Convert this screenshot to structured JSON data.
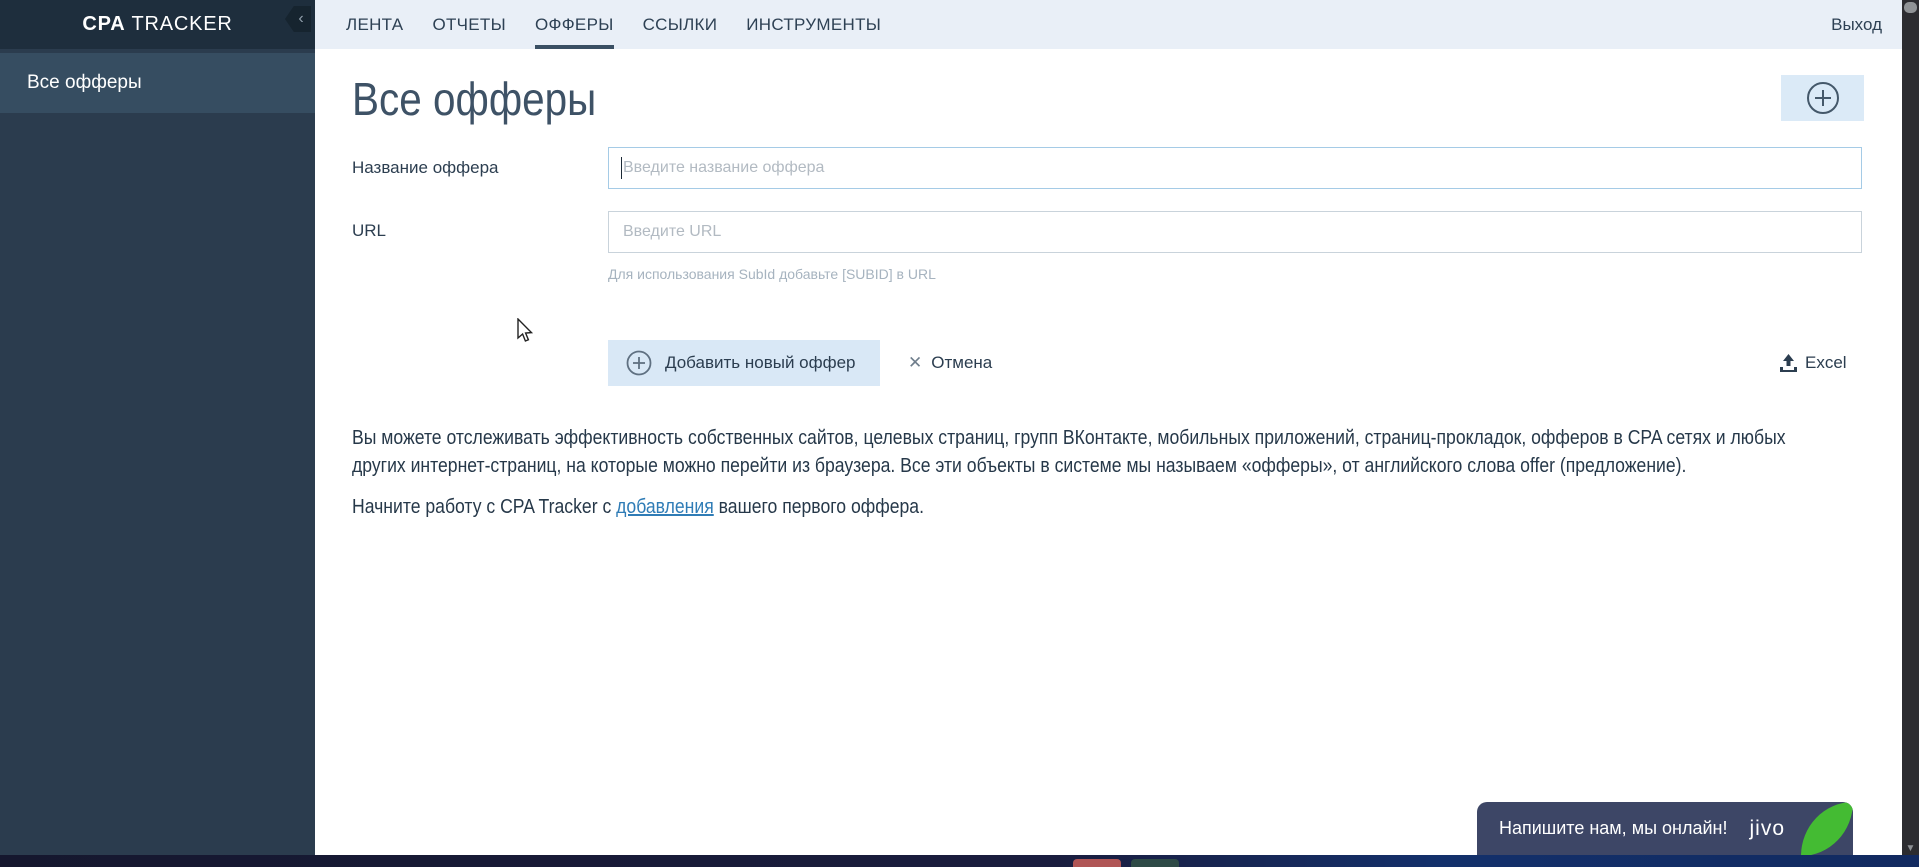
{
  "app": {
    "logo_bold": "CPA",
    "logo_rest": " TRACKER"
  },
  "sidebar": {
    "items": [
      {
        "label": "Все офферы",
        "active": true
      }
    ]
  },
  "nav": {
    "tabs": [
      {
        "label": "ЛЕНТА"
      },
      {
        "label": "ОТЧЕТЫ"
      },
      {
        "label": "ОФФЕРЫ",
        "active": true
      },
      {
        "label": "ССЫЛКИ"
      },
      {
        "label": "ИНСТРУМЕНТЫ"
      }
    ],
    "logout_label": "Выход"
  },
  "main": {
    "title": "Все офферы",
    "form": {
      "name_label": "Название оффера",
      "name_value": "",
      "name_placeholder": "Введите название оффера",
      "url_label": "URL",
      "url_value": "",
      "url_placeholder": "Введите URL",
      "url_hint": "Для использования SubId добавьте [SUBID] в URL",
      "submit_label": "Добавить новый оффер",
      "cancel_label": "Отмена",
      "excel_label": "Excel"
    },
    "description_p1": "Вы можете отслеживать эффективность собственных сайтов, целевых страниц, групп ВКонтакте, мобильных приложений, страниц-прокладок, офферов в CPA сетях и любых других интернет-страниц, на которые можно перейти из браузера. Все эти объекты в системе мы называем «офферы», от английского слова offer (предложение).",
    "description_p2_before": "Начните работу с CPA Tracker с ",
    "description_p2_link": "добавления",
    "description_p2_after": " вашего первого оффера."
  },
  "chat": {
    "message": "Напишите нам, мы онлайн!",
    "brand": "jivo"
  },
  "icons": {
    "collapse_chevron": "‹",
    "cancel_x": "✕",
    "scroll_down_arrow": "▼"
  },
  "colors": {
    "sidebar_bg": "#2b3c4e",
    "sidebar_header_bg": "#1e2e3d",
    "sidebar_active_bg": "#364d61",
    "nav_bg": "#e9eff7",
    "nav_text": "#2e4154",
    "active_tab_underline": "#3a4f63",
    "heading": "#3e5266",
    "button_bg": "#d9e8f6",
    "link": "#2f7cb6",
    "focused_input_border": "#a5cbe6",
    "jivo_bg": "#3d4666",
    "jivo_green": "#44bb33"
  }
}
